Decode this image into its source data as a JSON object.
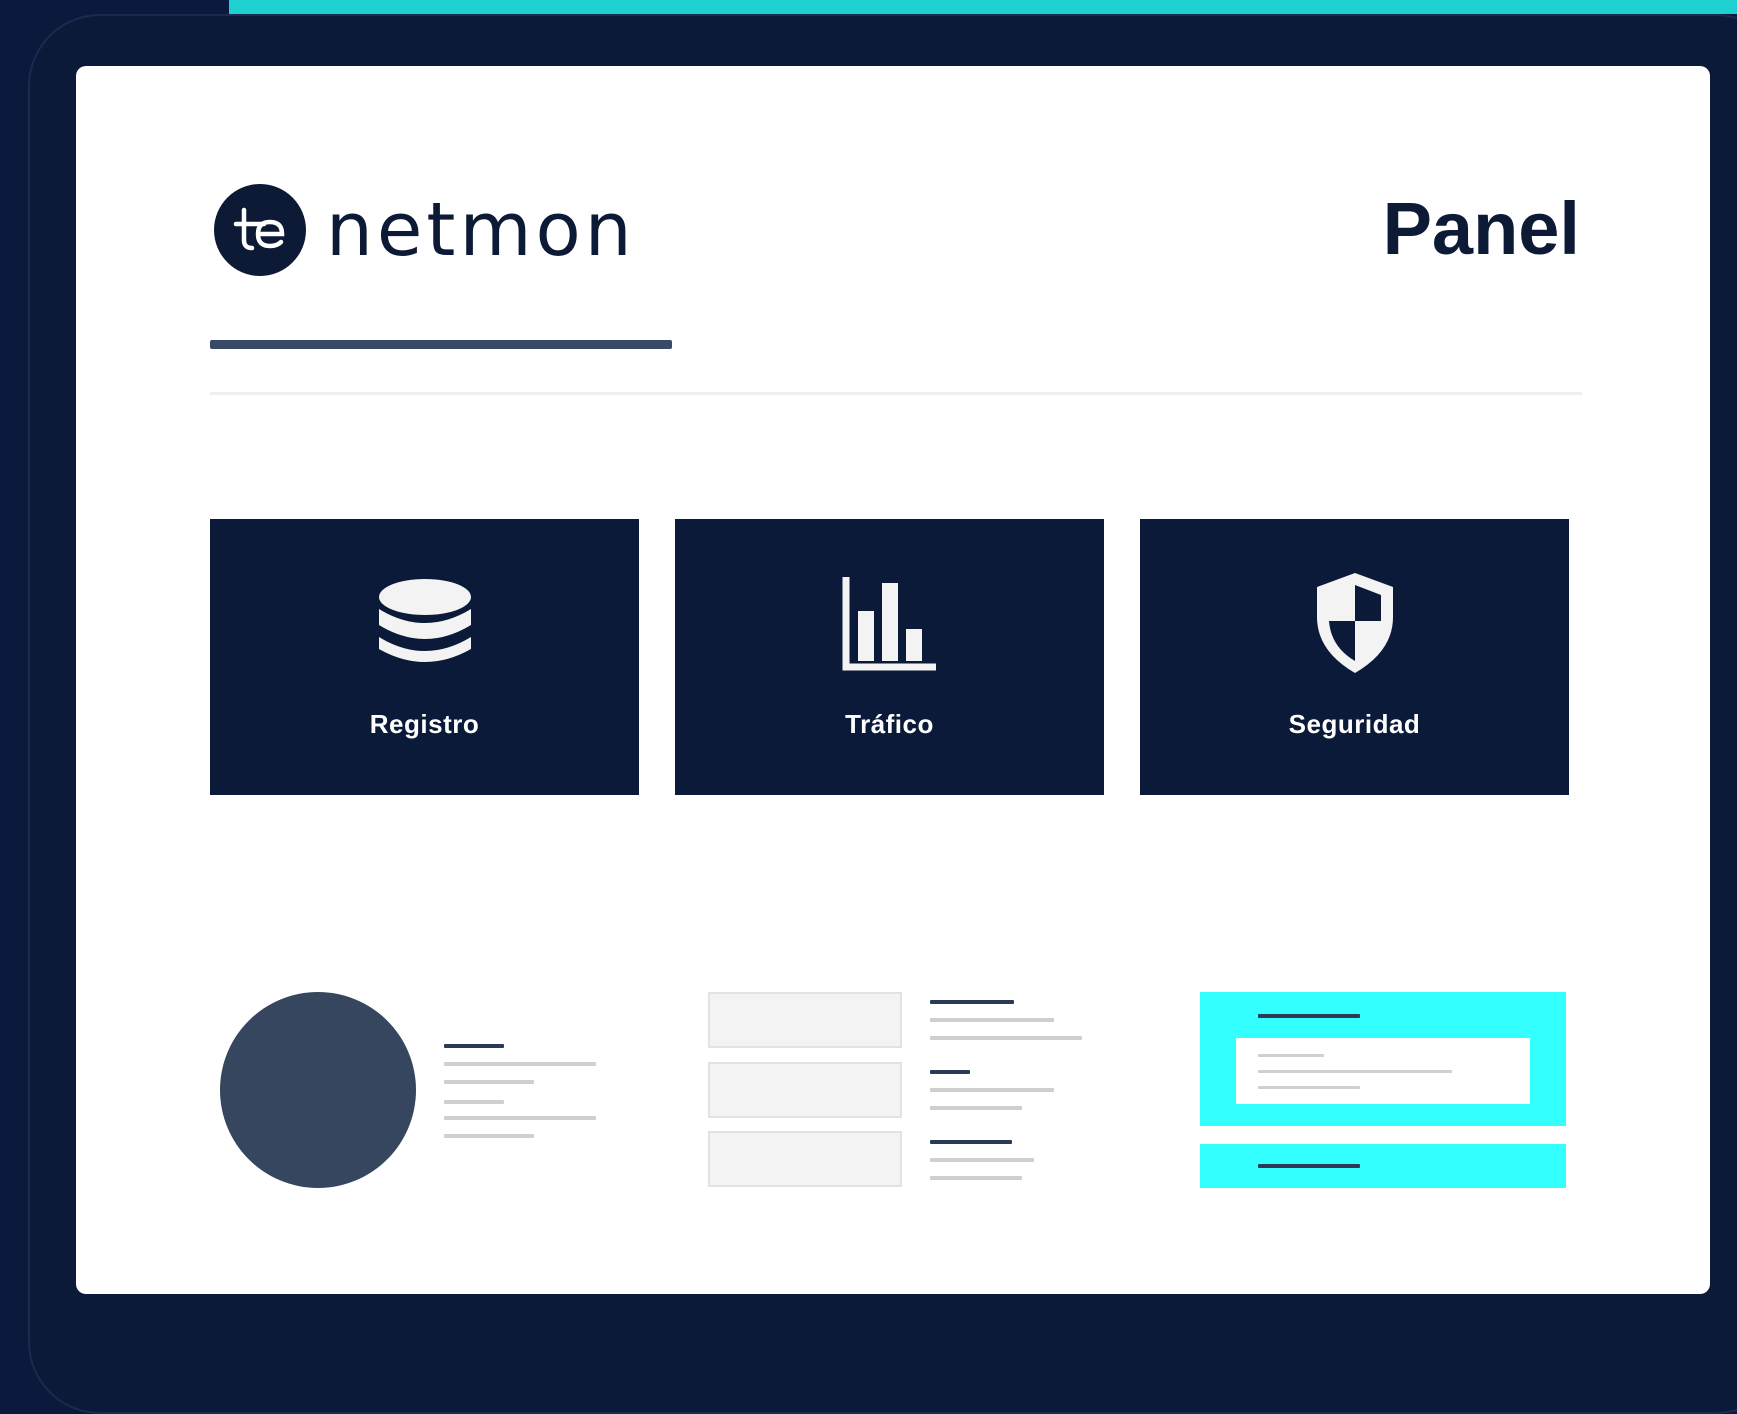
{
  "brand": {
    "name": "netmon",
    "mark_letters": "te"
  },
  "header": {
    "title": "Panel"
  },
  "tiles": [
    {
      "label": "Registro",
      "icon": "database-icon"
    },
    {
      "label": "Tráfico",
      "icon": "bar-chart-icon"
    },
    {
      "label": "Seguridad",
      "icon": "shield-icon"
    }
  ],
  "colors": {
    "background": "#0b1a3c",
    "device_frame": "#0a1a38",
    "accent_teal": "#1fd0d0",
    "accent_cyan": "#33ffff",
    "tile": "#0b1a38",
    "avatar": "#36465f"
  }
}
